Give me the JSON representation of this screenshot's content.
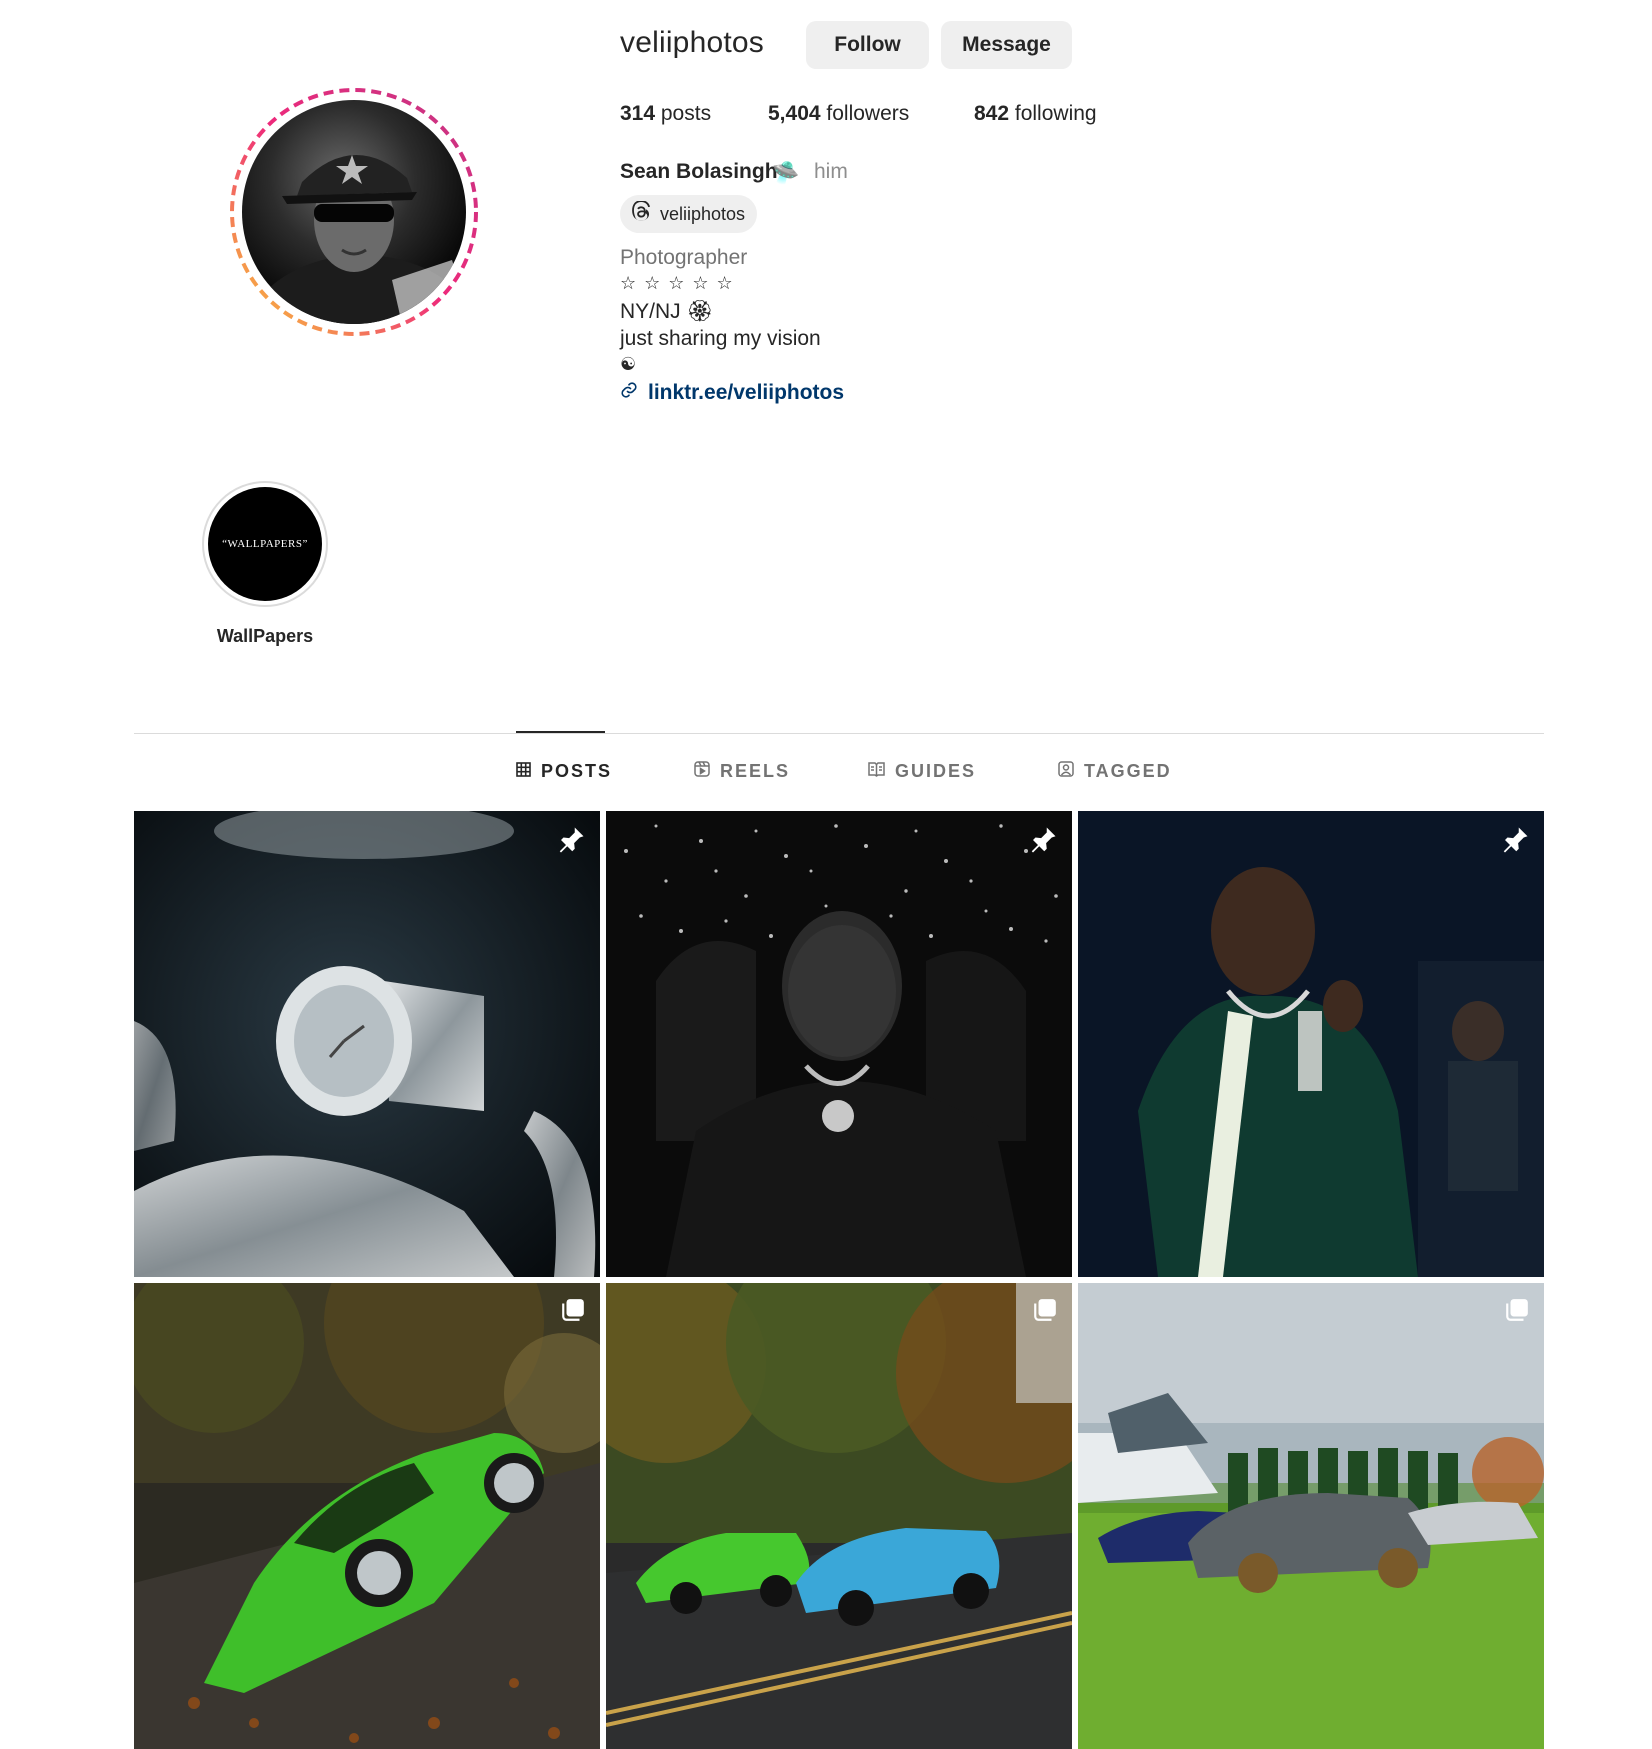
{
  "profile": {
    "username": "veliiphotos",
    "follow_label": "Follow",
    "message_label": "Message",
    "stats": {
      "posts_count": "314",
      "posts_label": " posts",
      "followers_count": "5,404",
      "followers_label": " followers",
      "following_count": "842",
      "following_label": " following"
    },
    "full_name": "Sean Bolasingh",
    "name_emoji": "🛸",
    "pronoun": "him",
    "threads_handle": "veliiphotos",
    "bio": {
      "category": "Photographer",
      "stars": "☆☆☆☆☆",
      "location": "NY/NJ 🏵",
      "line": "just sharing my vision",
      "symbol": "☯"
    },
    "link": "linktr.ee/veliiphotos"
  },
  "highlights": [
    {
      "label": "WallPapers",
      "cover_text": "“WALLPAPERS”"
    }
  ],
  "tabs": [
    {
      "label": "POSTS",
      "icon": "grid-icon",
      "active": true
    },
    {
      "label": "REELS",
      "icon": "reels-icon",
      "active": false
    },
    {
      "label": "GUIDES",
      "icon": "guides-icon",
      "active": false
    },
    {
      "label": "TAGGED",
      "icon": "tagged-icon",
      "active": false
    }
  ],
  "posts": [
    {
      "subject": "iced-out watch and cuban chain",
      "badge": "pin-icon"
    },
    {
      "subject": "masked man in car",
      "badge": "pin-icon"
    },
    {
      "subject": "man with chain portrait",
      "badge": "pin-icon"
    },
    {
      "subject": "green porsche on autumn road",
      "badge": "carousel-icon"
    },
    {
      "subject": "green and blue lamborghinis",
      "badge": "carousel-icon"
    },
    {
      "subject": "porsches on lawn",
      "badge": "carousel-icon"
    }
  ],
  "colors": {
    "button_bg": "#efefef",
    "link": "#00376b",
    "muted": "#737373",
    "ring_start": "#f9ce34",
    "ring_mid": "#ee2a7b",
    "ring_end": "#6228d7"
  }
}
